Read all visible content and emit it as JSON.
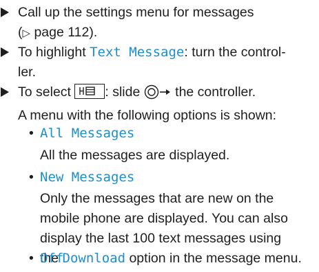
{
  "steps": [
    {
      "part1": "Call up the settings menu for messages",
      "part2_prefix": "(",
      "part2_tri": "▷",
      "part2_text": " page 112)."
    },
    {
      "pre": "To highlight ",
      "ui": "Text Message",
      "post": ": turn the control-",
      "line2": "ler."
    },
    {
      "pre": "To select ",
      "mid": ": slide ",
      "post": " the controller.",
      "line2": "A menu with the following options is shown:"
    }
  ],
  "options": [
    {
      "label": "All Messages",
      "desc": [
        "All the messages are displayed."
      ]
    },
    {
      "label": "New Messages",
      "desc": [
        "Only the messages that are new on the",
        "mobile phone are displayed. You can also",
        "display the last 100 text messages using"
      ],
      "desc_last_pre": "the ",
      "desc_last_ui": "Download",
      "desc_last_post": " option in the message menu."
    },
    {
      "label": "Off"
    }
  ],
  "bullet": "•",
  "icons": {
    "step_marker": "triangle-right-icon",
    "menu_key": "message-menu-key-icon",
    "controller": "controller-slide-right-icon"
  },
  "colors": {
    "ui_text": "#1b8fcf",
    "body_text": "#1e1e1e"
  }
}
